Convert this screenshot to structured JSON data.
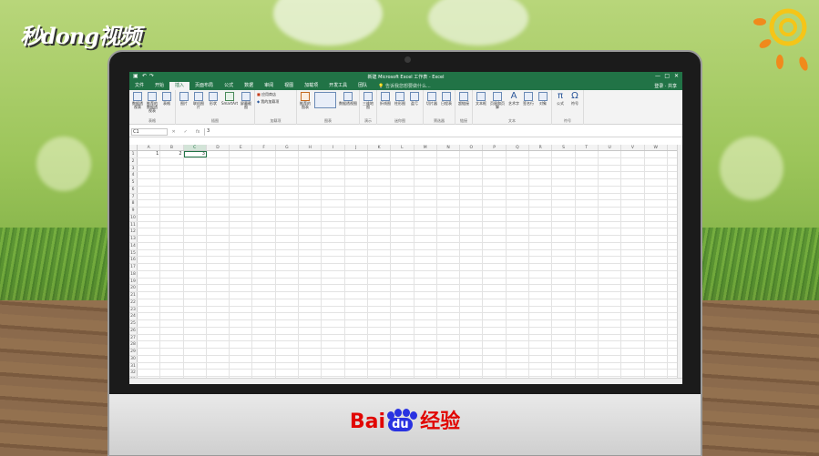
{
  "watermark": {
    "logo_text": "秒dong视频"
  },
  "brand": {
    "baidu_bai": "Bai",
    "baidu_du": "du",
    "baidu_jingyan": "经验"
  },
  "excel": {
    "title": "新建 Microsoft Excel 工作表 - Excel",
    "tabs": [
      "文件",
      "开始",
      "插入",
      "页面布局",
      "公式",
      "数据",
      "审阅",
      "视图",
      "加载项",
      "开发工具",
      "团队"
    ],
    "active_tab": "插入",
    "tell_me": "告诉我您想要做什么...",
    "login": "登录",
    "share": "共享",
    "ribbon_groups": [
      {
        "name": "表格",
        "buttons": [
          "数据透视表",
          "推荐的数据透视表",
          "表格"
        ]
      },
      {
        "name": "插图",
        "buttons": [
          "图片",
          "联机图片",
          "形状",
          "SmartArt",
          "屏幕截图"
        ]
      },
      {
        "name": "加载项",
        "buttons": [
          "应用商店",
          "我的加载项"
        ]
      },
      {
        "name": "图表",
        "buttons": [
          "推荐的图表",
          "数据透视图"
        ]
      },
      {
        "name": "演示",
        "buttons": [
          "三维地图"
        ]
      },
      {
        "name": "迷你图",
        "buttons": [
          "折线图",
          "柱形图",
          "盈亏"
        ]
      },
      {
        "name": "筛选器",
        "buttons": [
          "切片器",
          "日程表"
        ]
      },
      {
        "name": "链接",
        "buttons": [
          "超链接"
        ]
      },
      {
        "name": "文本",
        "buttons": [
          "文本框",
          "页眉和页脚",
          "艺术字",
          "签名行",
          "对象"
        ]
      },
      {
        "name": "符号",
        "buttons": [
          "公式",
          "符号"
        ]
      }
    ],
    "name_box": "C1",
    "formula_value": "3",
    "columns": [
      "A",
      "B",
      "C",
      "D",
      "E",
      "F",
      "G",
      "H",
      "I",
      "J",
      "K",
      "L",
      "M",
      "N",
      "O",
      "P",
      "Q",
      "R",
      "S",
      "T",
      "U",
      "V",
      "W"
    ],
    "active_column": "C",
    "row_numbers": [
      "1",
      "2",
      "3",
      "4",
      "5",
      "6",
      "7",
      "8",
      "9",
      "10",
      "11",
      "12",
      "13",
      "14",
      "15",
      "16",
      "17",
      "18",
      "19",
      "20",
      "21",
      "22",
      "23",
      "24",
      "25",
      "26",
      "27",
      "28",
      "29",
      "30",
      "31",
      "32",
      "33"
    ],
    "cells": {
      "A1": "1",
      "B1": "2",
      "C1": "3"
    }
  },
  "colors": {
    "excel_green": "#217346",
    "baidu_red": "#e10602",
    "baidu_blue": "#2932e1"
  }
}
